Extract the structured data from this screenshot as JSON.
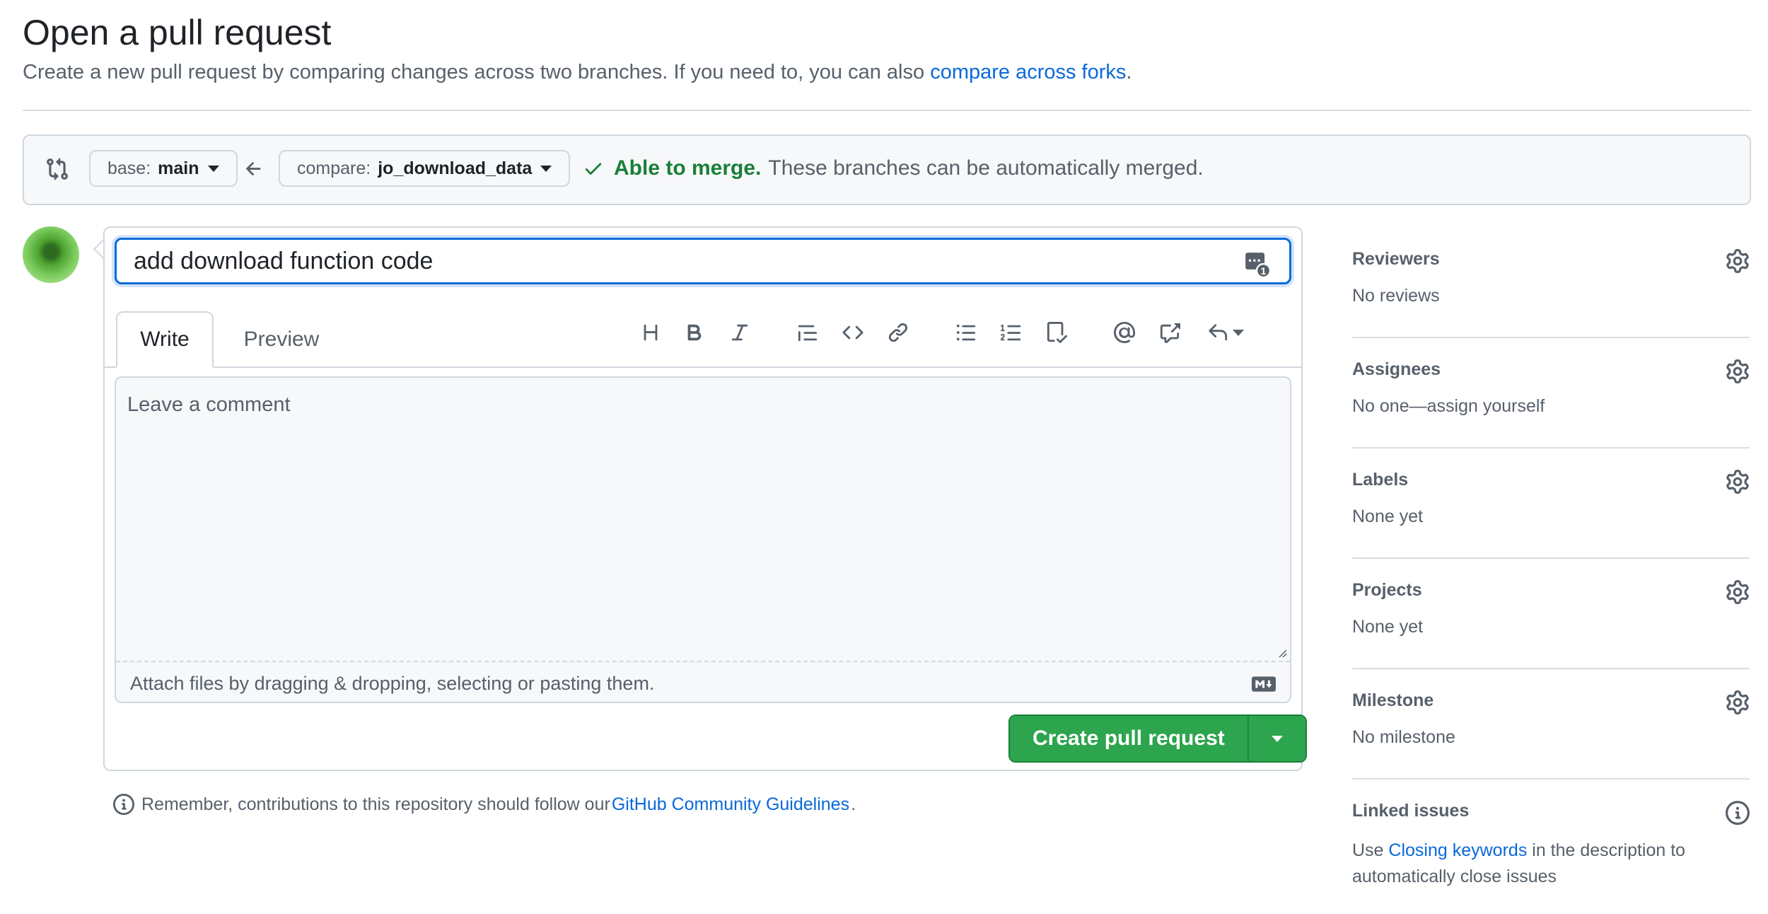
{
  "header": {
    "title": "Open a pull request",
    "subtitle_prefix": "Create a new pull request by comparing changes across two branches. If you need to, you can also ",
    "subtitle_link": "compare across forks",
    "subtitle_suffix": "."
  },
  "compare": {
    "base_prefix": "base:",
    "base_branch": "main",
    "compare_prefix": "compare:",
    "compare_branch": "jo_download_data",
    "merge_ok": "Able to merge.",
    "merge_text": "These branches can be automatically merged."
  },
  "form": {
    "title_value": "add download function code",
    "tab_write": "Write",
    "tab_preview": "Preview",
    "comment_placeholder": "Leave a comment",
    "attach_text": "Attach files by dragging & dropping, selecting or pasting them.",
    "submit_label": "Create pull request",
    "toolbar": [
      "heading-icon",
      "bold-icon",
      "italic-icon",
      "quote-icon",
      "code-icon",
      "link-icon",
      "unordered-list-icon",
      "ordered-list-icon",
      "task-list-icon",
      "mention-icon",
      "cross-reference-icon",
      "reply-icon"
    ]
  },
  "reminder": {
    "prefix": "Remember, contributions to this repository should follow our ",
    "link": "GitHub Community Guidelines",
    "suffix": "."
  },
  "sidebar": {
    "reviewers": {
      "label": "Reviewers",
      "value": "No reviews"
    },
    "assignees": {
      "label": "Assignees",
      "value": "No one—assign yourself"
    },
    "labels": {
      "label": "Labels",
      "value": "None yet"
    },
    "projects": {
      "label": "Projects",
      "value": "None yet"
    },
    "milestone": {
      "label": "Milestone",
      "value": "No milestone"
    },
    "linked_issues": {
      "label": "Linked issues",
      "text_prefix": "Use ",
      "text_link": "Closing keywords",
      "text_suffix": " in the description to automatically close issues"
    }
  },
  "colors": {
    "accent": "#0969da",
    "success": "#1a7f37",
    "button": "#2da44e",
    "muted": "#57606a"
  }
}
